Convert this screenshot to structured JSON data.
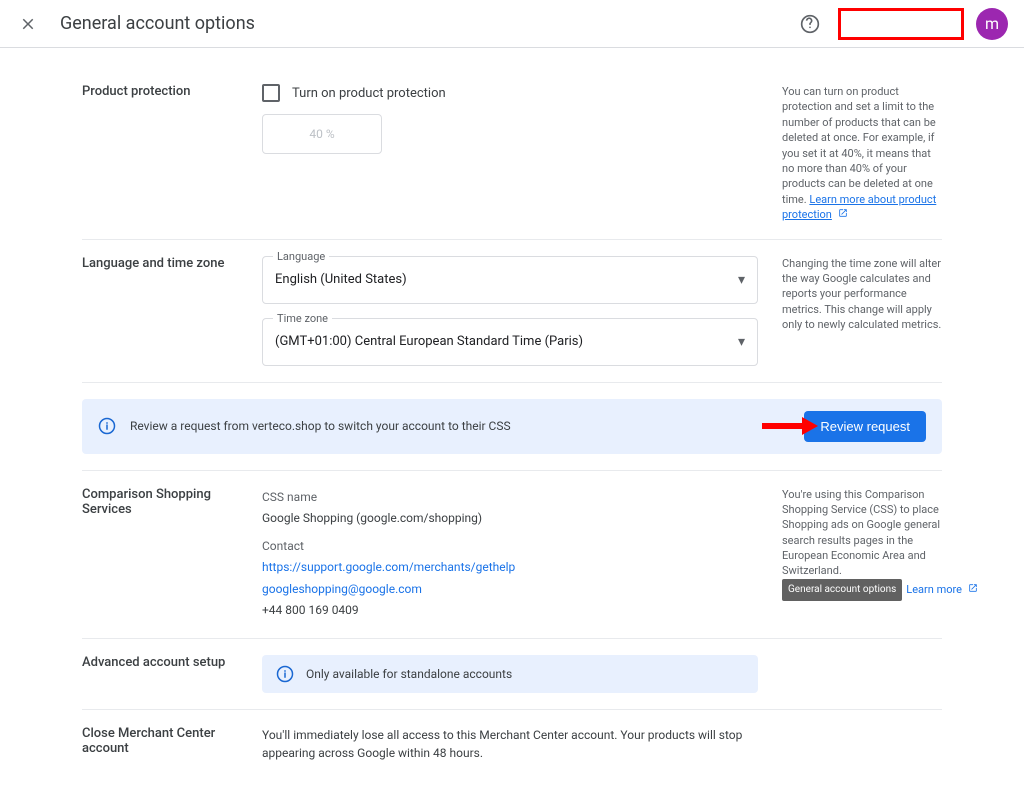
{
  "header": {
    "title": "General account options",
    "avatar_letter": "m"
  },
  "sections": {
    "protection": {
      "label": "Product protection",
      "checkbox_label": "Turn on product protection",
      "disabled_value": "40 %",
      "aside": "You can turn on product protection and set a limit to the number of products that can be deleted at once. For example, if you set it at 40%, it means that no more than 40% of your products can be deleted at one time.",
      "learn_more": "Learn more about product protection"
    },
    "language": {
      "label": "Language and time zone",
      "lang_field_label": "Language",
      "lang_value": "English (United States)",
      "tz_field_label": "Time zone",
      "tz_value": "(GMT+01:00) Central European Standard Time (Paris)",
      "aside": "Changing the time zone will alter the way Google calculates and reports your performance metrics. This change will apply only to newly calculated metrics."
    },
    "banner": {
      "text": "Review a request from verteco.shop to switch your account to their CSS",
      "button": "Review request"
    },
    "css": {
      "label": "Comparison Shopping Services",
      "name_label": "CSS name",
      "name_value": "Google Shopping (google.com/shopping)",
      "contact_label": "Contact",
      "contact_url": "https://support.google.com/merchants/gethelp",
      "contact_email": "googleshopping@google.com",
      "contact_phone": "+44 800 169 0409",
      "aside": "You're using this Comparison Shopping Service (CSS) to place Shopping ads on Google general search results pages in the European Economic Area and Switzerland.",
      "tooltip": "General account options",
      "learn_more": "Learn more"
    },
    "advanced": {
      "label": "Advanced account setup",
      "info_text": "Only available for standalone accounts"
    },
    "close": {
      "label": "Close Merchant Center account",
      "desc": "You'll immediately lose all access to this Merchant Center account. Your products will stop appearing across Google within 48 hours."
    }
  }
}
